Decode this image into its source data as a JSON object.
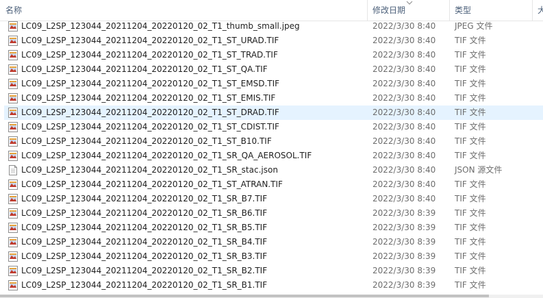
{
  "header": {
    "name_label": "名称",
    "date_label": "修改日期",
    "type_label": "类型",
    "size_label": "大"
  },
  "files": [
    {
      "name": "LC09_L2SP_123044_20211204_20220120_02_T1_thumb_small.jpeg",
      "date": "2022/3/30 8:40",
      "type": "JPEG 文件",
      "icon": "image-file-icon"
    },
    {
      "name": "LC09_L2SP_123044_20211204_20220120_02_T1_ST_URAD.TIF",
      "date": "2022/3/30 8:40",
      "type": "TIF 文件",
      "icon": "image-file-icon"
    },
    {
      "name": "LC09_L2SP_123044_20211204_20220120_02_T1_ST_TRAD.TIF",
      "date": "2022/3/30 8:40",
      "type": "TIF 文件",
      "icon": "image-file-icon"
    },
    {
      "name": "LC09_L2SP_123044_20211204_20220120_02_T1_ST_QA.TIF",
      "date": "2022/3/30 8:40",
      "type": "TIF 文件",
      "icon": "image-file-icon"
    },
    {
      "name": "LC09_L2SP_123044_20211204_20220120_02_T1_ST_EMSD.TIF",
      "date": "2022/3/30 8:40",
      "type": "TIF 文件",
      "icon": "image-file-icon"
    },
    {
      "name": "LC09_L2SP_123044_20211204_20220120_02_T1_ST_EMIS.TIF",
      "date": "2022/3/30 8:40",
      "type": "TIF 文件",
      "icon": "image-file-icon"
    },
    {
      "name": "LC09_L2SP_123044_20211204_20220120_02_T1_ST_DRAD.TIF",
      "date": "2022/3/30 8:40",
      "type": "TIF 文件",
      "icon": "image-file-icon",
      "selected": true
    },
    {
      "name": "LC09_L2SP_123044_20211204_20220120_02_T1_ST_CDIST.TIF",
      "date": "2022/3/30 8:40",
      "type": "TIF 文件",
      "icon": "image-file-icon"
    },
    {
      "name": "LC09_L2SP_123044_20211204_20220120_02_T1_ST_B10.TIF",
      "date": "2022/3/30 8:40",
      "type": "TIF 文件",
      "icon": "image-file-icon"
    },
    {
      "name": "LC09_L2SP_123044_20211204_20220120_02_T1_SR_QA_AEROSOL.TIF",
      "date": "2022/3/30 8:40",
      "type": "TIF 文件",
      "icon": "image-file-icon"
    },
    {
      "name": "LC09_L2SP_123044_20211204_20220120_02_T1_SR_stac.json",
      "date": "2022/3/30 8:40",
      "type": "JSON 源文件",
      "icon": "text-file-icon"
    },
    {
      "name": "LC09_L2SP_123044_20211204_20220120_02_T1_ST_ATRAN.TIF",
      "date": "2022/3/30 8:40",
      "type": "TIF 文件",
      "icon": "image-file-icon"
    },
    {
      "name": "LC09_L2SP_123044_20211204_20220120_02_T1_SR_B7.TIF",
      "date": "2022/3/30 8:40",
      "type": "TIF 文件",
      "icon": "image-file-icon"
    },
    {
      "name": "LC09_L2SP_123044_20211204_20220120_02_T1_SR_B6.TIF",
      "date": "2022/3/30 8:39",
      "type": "TIF 文件",
      "icon": "image-file-icon"
    },
    {
      "name": "LC09_L2SP_123044_20211204_20220120_02_T1_SR_B5.TIF",
      "date": "2022/3/30 8:39",
      "type": "TIF 文件",
      "icon": "image-file-icon"
    },
    {
      "name": "LC09_L2SP_123044_20211204_20220120_02_T1_SR_B4.TIF",
      "date": "2022/3/30 8:39",
      "type": "TIF 文件",
      "icon": "image-file-icon"
    },
    {
      "name": "LC09_L2SP_123044_20211204_20220120_02_T1_SR_B3.TIF",
      "date": "2022/3/30 8:39",
      "type": "TIF 文件",
      "icon": "image-file-icon"
    },
    {
      "name": "LC09_L2SP_123044_20211204_20220120_02_T1_SR_B2.TIF",
      "date": "2022/3/30 8:39",
      "type": "TIF 文件",
      "icon": "image-file-icon"
    },
    {
      "name": "LC09_L2SP_123044_20211204_20220120_02_T1_SR_B1.TIF",
      "date": "2022/3/30 8:39",
      "type": "TIF 文件",
      "icon": "image-file-icon"
    }
  ],
  "colors": {
    "selected_row": "#e5f3ff",
    "header_text": "#4c607a",
    "secondary_text": "#6d6d6d"
  }
}
